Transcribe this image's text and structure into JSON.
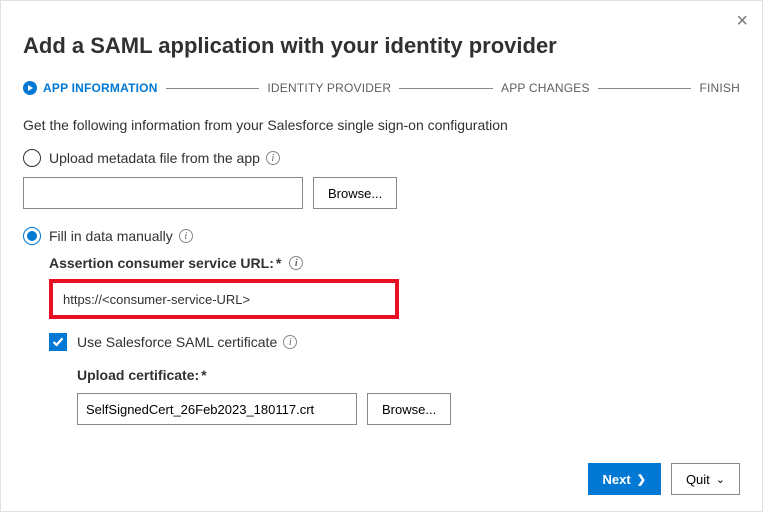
{
  "title": "Add a SAML application with your identity provider",
  "stepper": {
    "s1": "APP INFORMATION",
    "s2": "IDENTITY PROVIDER",
    "s3": "APP CHANGES",
    "s4": "FINISH"
  },
  "intro": "Get the following information from your Salesforce single sign-on configuration",
  "option_upload": "Upload metadata file from the app",
  "option_manual": "Fill in data manually",
  "browse_label": "Browse...",
  "acs": {
    "label": "Assertion consumer service URL:",
    "required": "*",
    "value": "https://<consumer-service-URL>"
  },
  "use_cert_label": "Use Salesforce SAML certificate",
  "upload_cert": {
    "label": "Upload certificate:",
    "required": "*",
    "filename": "SelfSignedCert_26Feb2023_180117.crt"
  },
  "footer": {
    "next": "Next",
    "quit": "Quit"
  }
}
